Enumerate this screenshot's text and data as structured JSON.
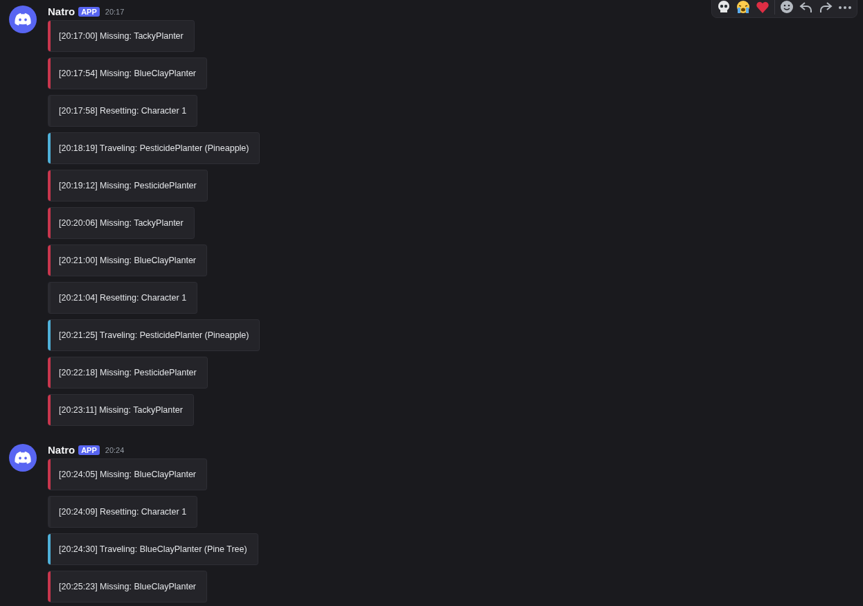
{
  "messages": [
    {
      "author": "Natro",
      "badge": "APP",
      "time": "20:17",
      "embeds": [
        {
          "text": "[20:17:00] Missing: TackyPlanter",
          "color": "#c8364d"
        },
        {
          "text": "[20:17:54] Missing: BlueClayPlanter",
          "color": "#c8364d"
        },
        {
          "text": "[20:17:58] Resetting: Character 1",
          "color": "#2b2b31"
        },
        {
          "text": "[20:18:19] Traveling: PesticidePlanter (Pineapple)",
          "color": "#4fb0d8"
        },
        {
          "text": "[20:19:12] Missing: PesticidePlanter",
          "color": "#c8364d"
        },
        {
          "text": "[20:20:06] Missing: TackyPlanter",
          "color": "#c8364d"
        },
        {
          "text": "[20:21:00] Missing: BlueClayPlanter",
          "color": "#c8364d"
        },
        {
          "text": "[20:21:04] Resetting: Character 1",
          "color": "#2b2b31"
        },
        {
          "text": "[20:21:25] Traveling: PesticidePlanter (Pineapple)",
          "color": "#4fb0d8"
        },
        {
          "text": "[20:22:18] Missing: PesticidePlanter",
          "color": "#c8364d"
        },
        {
          "text": "[20:23:11] Missing: TackyPlanter",
          "color": "#c8364d"
        }
      ]
    },
    {
      "author": "Natro",
      "badge": "APP",
      "time": "20:24",
      "embeds": [
        {
          "text": "[20:24:05] Missing: BlueClayPlanter",
          "color": "#c8364d"
        },
        {
          "text": "[20:24:09] Resetting: Character 1",
          "color": "#2b2b31"
        },
        {
          "text": "[20:24:30] Traveling: BlueClayPlanter (Pine Tree)",
          "color": "#4fb0d8"
        },
        {
          "text": "[20:25:23] Missing: BlueClayPlanter",
          "color": "#c8364d"
        }
      ]
    }
  ],
  "toolbar": [
    {
      "kind": "skull"
    },
    {
      "kind": "crying"
    },
    {
      "kind": "heart"
    },
    {
      "kind": "divider"
    },
    {
      "kind": "react"
    },
    {
      "kind": "reply"
    },
    {
      "kind": "forward"
    },
    {
      "kind": "more"
    }
  ]
}
